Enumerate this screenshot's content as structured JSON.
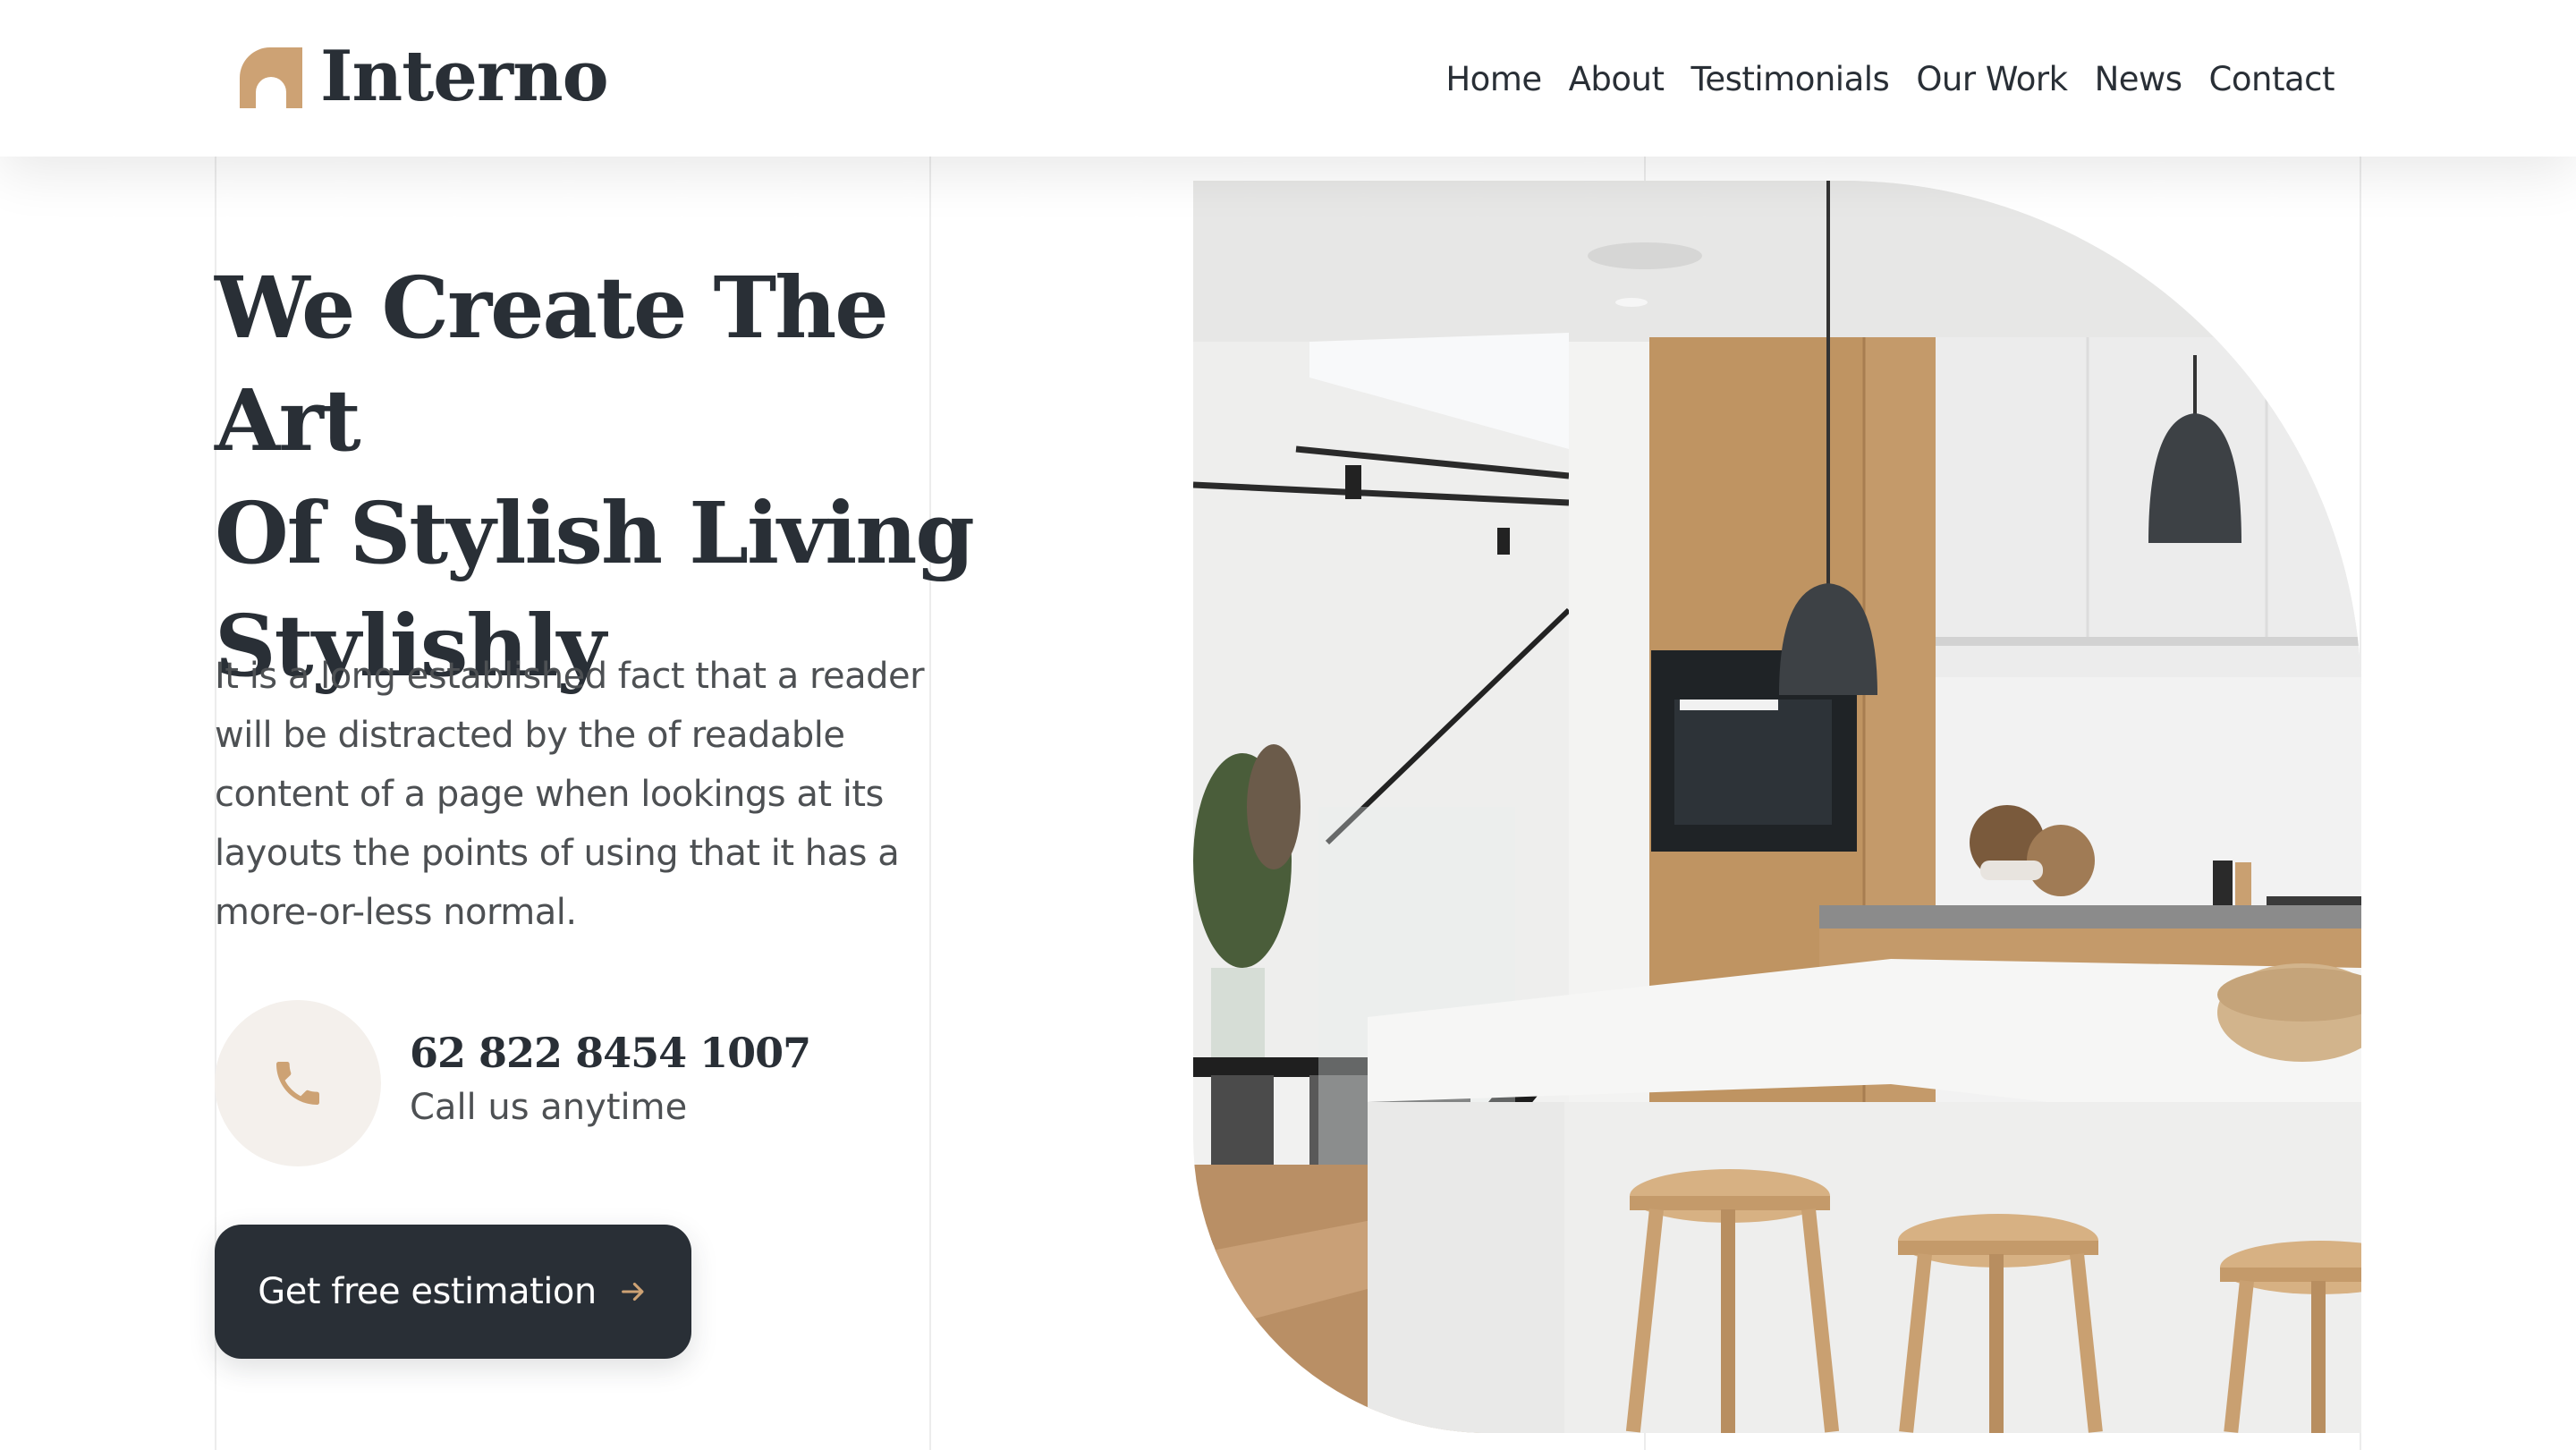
{
  "brand": {
    "name": "Interno",
    "accent_color": "#cda274",
    "dark_color": "#292f36",
    "icon": "arch-logo-icon"
  },
  "nav": {
    "items": [
      {
        "label": "Home"
      },
      {
        "label": "About"
      },
      {
        "label": "Testimonials"
      },
      {
        "label": "Our Work"
      },
      {
        "label": "News"
      },
      {
        "label": "Contact"
      }
    ]
  },
  "hero": {
    "title_lines": [
      "We Create The Art",
      "Of Stylish Living",
      "Stylishly"
    ],
    "description": "It is a long established fact that a reader will be distracted by the of readable content of a page when lookings at its layouts the points of using that it has a more-or-less normal.",
    "phone": {
      "icon": "phone-icon",
      "number": "62 822 8454 1007",
      "caption": "Call us anytime"
    },
    "cta": {
      "label": "Get free estimation",
      "icon": "arrow-right-icon"
    },
    "image": {
      "icon": "kitchen-photo"
    }
  }
}
